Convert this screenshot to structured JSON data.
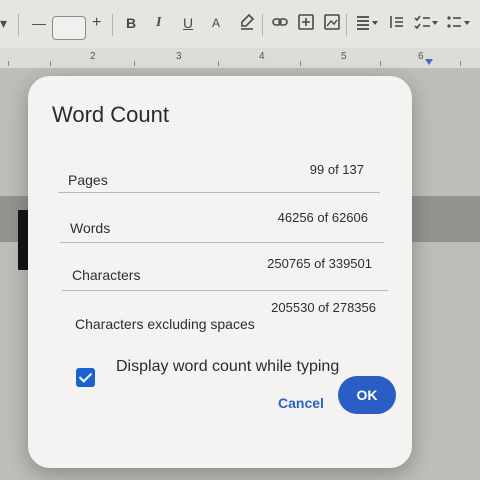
{
  "toolbar": {
    "chevron": "▾",
    "minus": "—",
    "plus": "+",
    "bold": "B",
    "italic": "I",
    "underline": "U",
    "text_color": "A",
    "icons": [
      "highlighter-icon",
      "link-icon",
      "add-comment-icon",
      "insert-image-icon",
      "align-icon",
      "line-spacing-icon",
      "checklist-icon",
      "bulleted-list-icon"
    ]
  },
  "ruler": {
    "numbers": [
      "2",
      "3",
      "4",
      "5",
      "6"
    ]
  },
  "dialog": {
    "title": "Word Count",
    "rows": [
      {
        "label": "Pages",
        "value": "99 of 137"
      },
      {
        "label": "Words",
        "value": "46256 of 62606"
      },
      {
        "label": "Characters",
        "value": "250765 of 339501"
      },
      {
        "label": "Characters excluding spaces",
        "value": "205530 of 278356"
      }
    ],
    "checkbox": {
      "label": "Display word count while typing",
      "checked": true
    },
    "cancel_label": "Cancel",
    "ok_label": "OK"
  },
  "colors": {
    "accent": "#2b5ec4",
    "dialog_bg": "#f4f3f1"
  }
}
